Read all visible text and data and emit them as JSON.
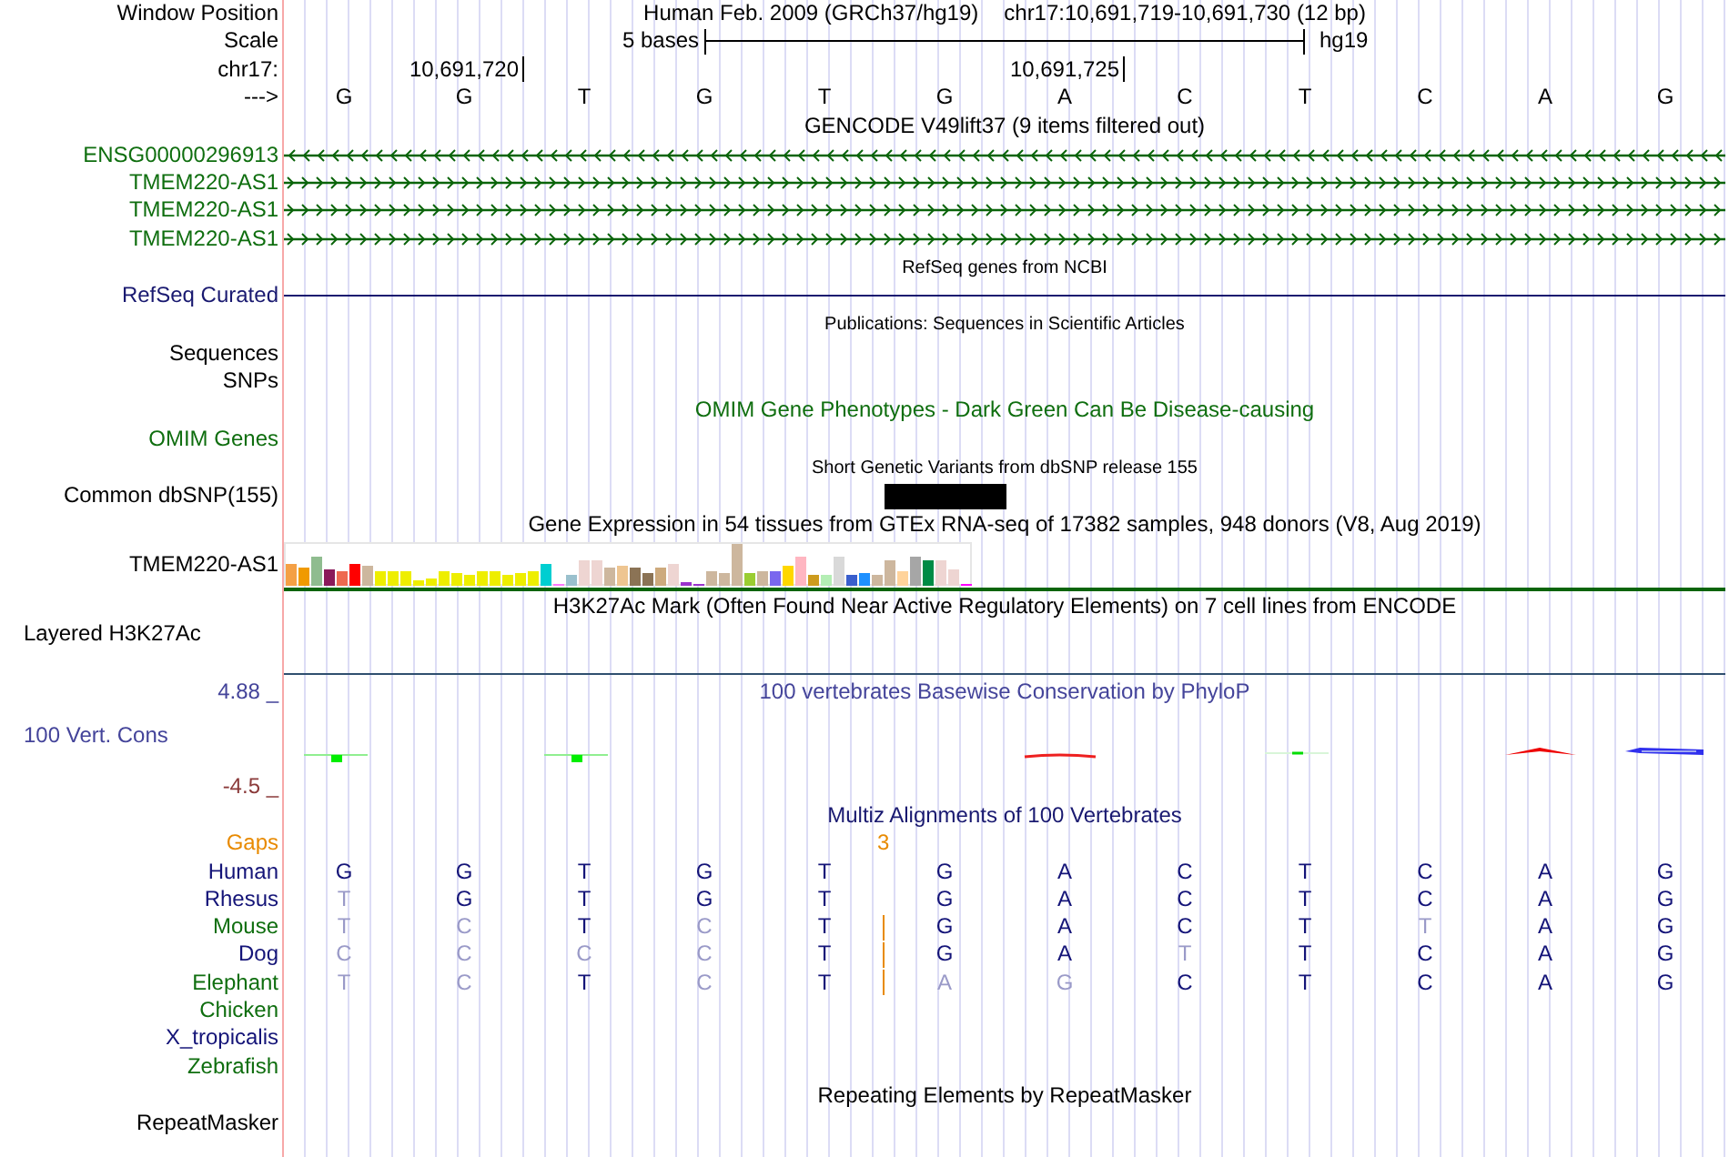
{
  "header": {
    "position_label": "Window Position",
    "assembly": "Human Feb. 2009 (GRCh37/hg19)",
    "position": "chr17:10,691,719-10,691,730 (12 bp)",
    "scale_label": "Scale",
    "scale_text": "5 bases",
    "scale_assembly": "hg19",
    "chrom_label": "chr17:",
    "ticks": [
      "10,691,720",
      "10,691,725"
    ],
    "strand_label": "--->",
    "bases": [
      "G",
      "G",
      "T",
      "G",
      "T",
      "G",
      "A",
      "C",
      "T",
      "C",
      "A",
      "G"
    ]
  },
  "tracks": [
    {
      "kind": "genes",
      "title": "GENCODE V49lift37 (9 items filtered out)",
      "items": [
        {
          "name": "ENSG00000296913",
          "reverse": true
        },
        {
          "name": "TMEM220-AS1",
          "reverse": false
        },
        {
          "name": "TMEM220-AS1",
          "reverse": false
        },
        {
          "name": "TMEM220-AS1",
          "reverse": false
        }
      ]
    },
    {
      "kind": "line",
      "title": "RefSeq genes from NCBI",
      "labels": [
        "RefSeq Curated"
      ]
    },
    {
      "kind": "publications",
      "title": "Publications: Sequences in Scientific Articles",
      "labels": [
        "Sequences",
        "SNPs"
      ]
    },
    {
      "kind": "omim",
      "title": "OMIM Gene Phenotypes - Dark Green Can Be Disease-causing",
      "labels": [
        "OMIM Genes"
      ]
    },
    {
      "kind": "snp",
      "title": "Short Genetic Variants from dbSNP release 155",
      "labels": [
        "Common dbSNP(155)"
      ]
    },
    {
      "kind": "expression",
      "title": "Gene Expression in 54 tissues from GTEx RNA-seq of 17382 samples, 948 donors (V8, Aug 2019)",
      "labels": [
        "TMEM220-AS1"
      ]
    },
    {
      "kind": "signal",
      "title": "H3K27Ac Mark (Often Found Near Active Regulatory Elements) on 7 cell lines from ENCODE",
      "labels": [
        "Layered H3K27Ac"
      ]
    },
    {
      "kind": "conservation",
      "title": "100 vertebrates Basewise Conservation by PhyloP",
      "labels": [
        "100 Vert. Cons"
      ],
      "max": "4.88 _",
      "min": "-4.5 _"
    },
    {
      "kind": "alignment",
      "title": "Multiz Alignments of 100 Vertebrates",
      "gaps_label": "Gaps",
      "gap_count": "3",
      "species": [
        {
          "name": "Human",
          "color": "#141478",
          "gap": false,
          "bases": [
            {
              "base": "G",
              "faint": false
            },
            {
              "base": "G",
              "faint": false
            },
            {
              "base": "T",
              "faint": false
            },
            {
              "base": "G",
              "faint": false
            },
            {
              "base": "T",
              "faint": false
            },
            {
              "base": "G",
              "faint": false
            },
            {
              "base": "A",
              "faint": false
            },
            {
              "base": "C",
              "faint": false
            },
            {
              "base": "T",
              "faint": false
            },
            {
              "base": "C",
              "faint": false
            },
            {
              "base": "A",
              "faint": false
            },
            {
              "base": "G",
              "faint": false
            }
          ]
        },
        {
          "name": "Rhesus",
          "color": "#141478",
          "gap": false,
          "bases": [
            {
              "base": "T",
              "faint": true
            },
            {
              "base": "G",
              "faint": false
            },
            {
              "base": "T",
              "faint": false
            },
            {
              "base": "G",
              "faint": false
            },
            {
              "base": "T",
              "faint": false
            },
            {
              "base": "G",
              "faint": false
            },
            {
              "base": "A",
              "faint": false
            },
            {
              "base": "C",
              "faint": false
            },
            {
              "base": "T",
              "faint": false
            },
            {
              "base": "C",
              "faint": false
            },
            {
              "base": "A",
              "faint": false
            },
            {
              "base": "G",
              "faint": false
            }
          ]
        },
        {
          "name": "Mouse",
          "color": "#0f6e0f",
          "gap": true,
          "bases": [
            {
              "base": "T",
              "faint": true
            },
            {
              "base": "C",
              "faint": true
            },
            {
              "base": "T",
              "faint": false
            },
            {
              "base": "C",
              "faint": true
            },
            {
              "base": "T",
              "faint": false
            },
            {
              "base": "G",
              "faint": false
            },
            {
              "base": "A",
              "faint": false
            },
            {
              "base": "C",
              "faint": false
            },
            {
              "base": "T",
              "faint": false
            },
            {
              "base": "T",
              "faint": true
            },
            {
              "base": "A",
              "faint": false
            },
            {
              "base": "G",
              "faint": false
            }
          ]
        },
        {
          "name": "Dog",
          "color": "#141478",
          "gap": true,
          "bases": [
            {
              "base": "C",
              "faint": true
            },
            {
              "base": "C",
              "faint": true
            },
            {
              "base": "C",
              "faint": true
            },
            {
              "base": "C",
              "faint": true
            },
            {
              "base": "T",
              "faint": false
            },
            {
              "base": "G",
              "faint": false
            },
            {
              "base": "A",
              "faint": false
            },
            {
              "base": "T",
              "faint": true
            },
            {
              "base": "T",
              "faint": false
            },
            {
              "base": "C",
              "faint": false
            },
            {
              "base": "A",
              "faint": false
            },
            {
              "base": "G",
              "faint": false
            }
          ]
        },
        {
          "name": "Elephant",
          "color": "#0f6e0f",
          "gap": true,
          "bases": [
            {
              "base": "T",
              "faint": true
            },
            {
              "base": "C",
              "faint": true
            },
            {
              "base": "T",
              "faint": false
            },
            {
              "base": "C",
              "faint": true
            },
            {
              "base": "T",
              "faint": false
            },
            {
              "base": "A",
              "faint": true
            },
            {
              "base": "G",
              "faint": true
            },
            {
              "base": "C",
              "faint": false
            },
            {
              "base": "T",
              "faint": false
            },
            {
              "base": "C",
              "faint": false
            },
            {
              "base": "A",
              "faint": false
            },
            {
              "base": "G",
              "faint": false
            }
          ]
        },
        {
          "name": "Chicken",
          "color": "#0f6e0f",
          "gap": false
        },
        {
          "name": "X_tropicalis",
          "color": "#141478",
          "gap": false
        },
        {
          "name": "Zebrafish",
          "color": "#0f6e0f",
          "gap": false
        }
      ]
    },
    {
      "kind": "repeats",
      "title": "Repeating Elements by RepeatMasker",
      "labels": [
        "RepeatMasker"
      ]
    }
  ]
}
